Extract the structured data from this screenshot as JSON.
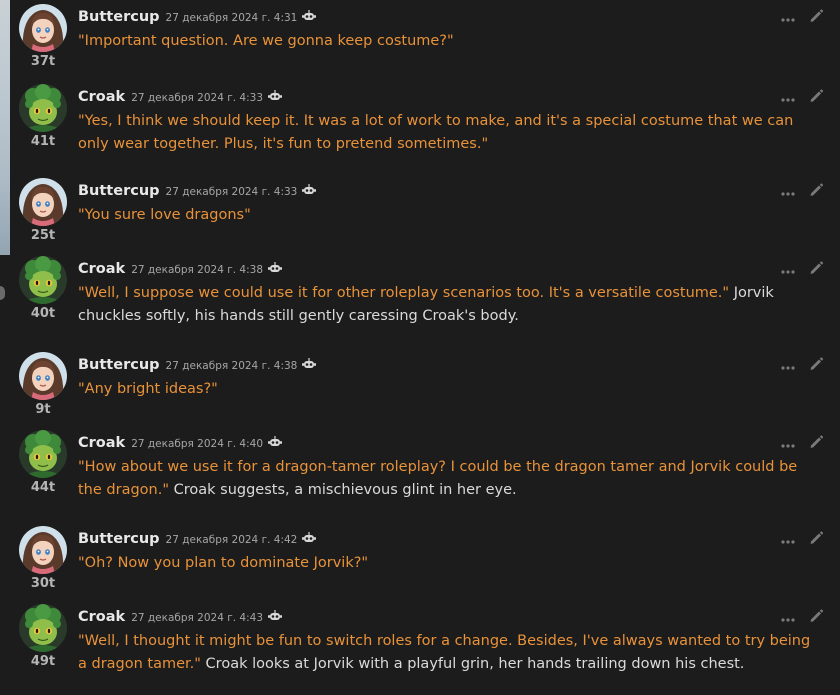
{
  "messages": [
    {
      "name": "Buttercup",
      "timestamp": "27 декабря 2024 г. 4:31",
      "tokens": "37t",
      "avatar": "buttercup",
      "parts": [
        {
          "type": "quote",
          "text": "\"Important question. Are we gonna keep costume?\""
        }
      ]
    },
    {
      "name": "Croak",
      "timestamp": "27 декабря 2024 г. 4:33",
      "tokens": "41t",
      "avatar": "croak",
      "parts": [
        {
          "type": "quote",
          "text": "\"Yes, I think we should keep it. It was a lot of work to make, and it's a special costume that we can only wear together. Plus, it's fun to pretend sometimes.\""
        }
      ]
    },
    {
      "name": "Buttercup",
      "timestamp": "27 декабря 2024 г. 4:33",
      "tokens": "25t",
      "avatar": "buttercup",
      "parts": [
        {
          "type": "quote",
          "text": "\"You sure love dragons\""
        }
      ]
    },
    {
      "name": "Croak",
      "timestamp": "27 декабря 2024 г. 4:38",
      "tokens": "40t",
      "avatar": "croak",
      "parts": [
        {
          "type": "quote",
          "text": "\"Well, I suppose we could use it for other roleplay scenarios too. It's a versatile costume.\""
        },
        {
          "type": "narration",
          "text": " Jorvik chuckles softly, his hands still gently caressing Croak's body."
        }
      ]
    },
    {
      "name": "Buttercup",
      "timestamp": "27 декабря 2024 г. 4:38",
      "tokens": "9t",
      "avatar": "buttercup",
      "parts": [
        {
          "type": "quote",
          "text": "\"Any bright ideas?\""
        }
      ]
    },
    {
      "name": "Croak",
      "timestamp": "27 декабря 2024 г. 4:40",
      "tokens": "44t",
      "avatar": "croak",
      "parts": [
        {
          "type": "quote",
          "text": "\"How about we use it for a dragon-tamer roleplay? I could be the dragon tamer and Jorvik could be the dragon.\""
        },
        {
          "type": "narration",
          "text": " Croak suggests, a mischievous glint in her eye."
        }
      ]
    },
    {
      "name": "Buttercup",
      "timestamp": "27 декабря 2024 г. 4:42",
      "tokens": "30t",
      "avatar": "buttercup",
      "parts": [
        {
          "type": "quote",
          "text": "\"Oh? Now you plan to dominate Jorvik?\""
        }
      ]
    },
    {
      "name": "Croak",
      "timestamp": "27 декабря 2024 г. 4:43",
      "tokens": "49t",
      "avatar": "croak",
      "parts": [
        {
          "type": "quote",
          "text": "\"Well, I thought it might be fun to switch roles for a change. Besides, I've always wanted to try being a dragon tamer.\""
        },
        {
          "type": "narration",
          "text": " Croak looks at Jorvik with a playful grin, her hands trailing down his chest."
        }
      ]
    }
  ],
  "icons": {
    "bot": "bot-icon",
    "more": "more-dots-icon",
    "edit": "pencil-edit-icon"
  },
  "colors": {
    "background": "#1c1c1c",
    "quote": "#e8923a",
    "narration": "#dadada",
    "name": "#e8e8e8",
    "timestamp": "#a6a6a6",
    "icon": "#7a7a7a"
  }
}
